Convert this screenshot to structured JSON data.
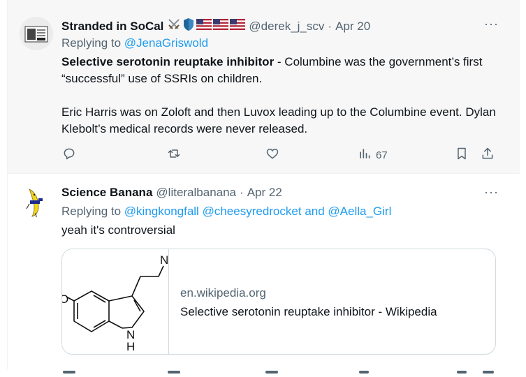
{
  "tweets": [
    {
      "author": "Stranded in SoCal",
      "emojis": [
        "crossed-swords-icon",
        "shield-icon",
        "us-flag-icon",
        "us-flag-icon",
        "us-flag-icon"
      ],
      "handle": "@derek_j_scv",
      "separator": "·",
      "date": "Apr 20",
      "replying_prefix": "Replying to",
      "replying_to": "@JenaGriswold",
      "text_bold": "Selective serotonin reuptake inhibitor",
      "text_rest": " - Columbine was the government’s first “successful” use of SSRIs on children.",
      "text_p2": "Eric Harris was on Zoloft and then Luvox leading up to the Columbine event. Dylan Klebolt’s medical records were never released.",
      "views": "67",
      "more": "···"
    },
    {
      "author": "Science Banana",
      "handle": "@literalbanana",
      "separator": "·",
      "date": "Apr 22",
      "replying_prefix": "Replying to",
      "mention1": "@kingkongfall",
      "mention2": "@cheesyredrocket",
      "and_word": "and",
      "mention3": "@Aella_Girl",
      "text": "yeah it's controversial",
      "more": "···",
      "card": {
        "domain": "en.wikipedia.org",
        "title": "Selective serotonin reuptake inhibitor - Wikipedia",
        "atom_n": "N",
        "atom_nh_n": "N",
        "atom_nh_h": "H",
        "atom_o": "O"
      }
    }
  ],
  "colors": {
    "accent": "#1d9bf0",
    "muted": "#536471",
    "text": "#0f1419"
  }
}
